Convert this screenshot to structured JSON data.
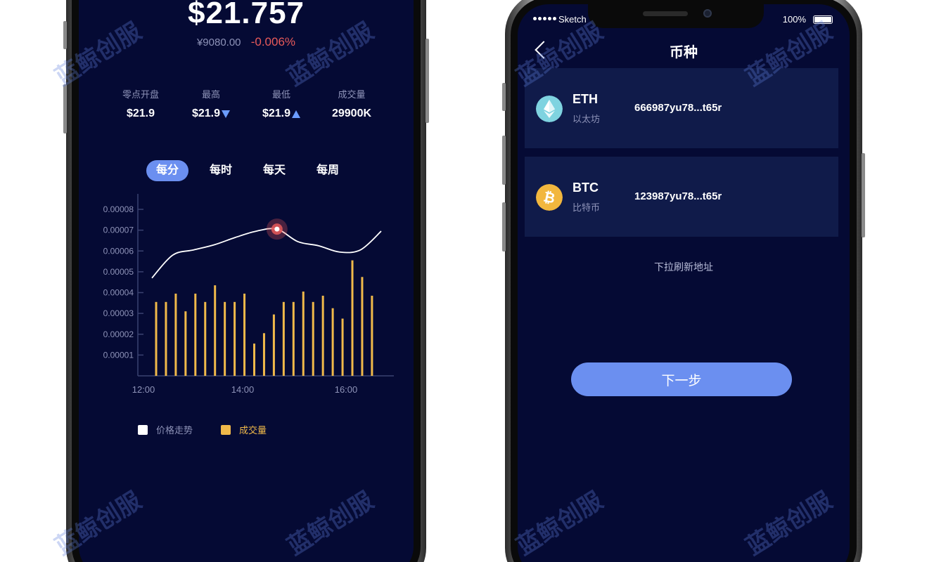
{
  "left_screen": {
    "price": "$21.757",
    "price_cny": "¥9080.00",
    "change": "-0.006%",
    "stats": [
      {
        "label": "零点开盘",
        "value": "$21.9",
        "arrow": "none"
      },
      {
        "label": "最高",
        "value": "$21.9",
        "arrow": "down"
      },
      {
        "label": "最低",
        "value": "$21.9",
        "arrow": "up"
      },
      {
        "label": "成交量",
        "value": "29900K",
        "arrow": "none"
      }
    ],
    "tabs": [
      "每分",
      "每时",
      "每天",
      "每周"
    ],
    "active_tab": "每分",
    "legend": [
      {
        "label": "价格走势",
        "color": "#ffffff"
      },
      {
        "label": "成交量",
        "color": "#f0b94a"
      }
    ]
  },
  "chart_data": {
    "type": "bar",
    "y_tick_labels": [
      "0.00008",
      "0.00007",
      "0.00006",
      "0.00005",
      "0.00004",
      "0.00003",
      "0.00002",
      "0.00001"
    ],
    "x_tick_labels": [
      "12:00",
      "14:00",
      "16:00"
    ],
    "ylim": [
      0,
      8e-05
    ],
    "series": [
      {
        "name": "成交量",
        "type": "bar",
        "color": "#f0b94a",
        "values": [
          3.55e-05,
          3.55e-05,
          3.95e-05,
          3.1e-05,
          3.95e-05,
          3.55e-05,
          4.35e-05,
          3.55e-05,
          3.55e-05,
          3.95e-05,
          1.55e-05,
          2.05e-05,
          2.95e-05,
          3.55e-05,
          3.55e-05,
          4.05e-05,
          3.55e-05,
          3.85e-05,
          3.25e-05,
          2.75e-05,
          5.55e-05,
          4.75e-05,
          3.85e-05
        ]
      },
      {
        "name": "价格走势",
        "type": "line",
        "color": "#ffffff",
        "values": [
          4.7e-05,
          5.8e-05,
          6.05e-05,
          6.3e-05,
          6.65e-05,
          6.95e-05,
          7.05e-05,
          6.45e-05,
          6.25e-05,
          5.95e-05,
          6.05e-05,
          6.95e-05
        ],
        "highlight_index": 6
      }
    ],
    "grid": false,
    "legend_position": "bottom-left"
  },
  "right_screen": {
    "status": {
      "carrier": "Sketch",
      "battery": "100%"
    },
    "title": "币种",
    "coins": [
      {
        "symbol": "ETH",
        "name": "以太坊",
        "address": "666987yu78...t65r",
        "icon": "ethereum-icon",
        "icon_color": "#7fd3e0"
      },
      {
        "symbol": "BTC",
        "name": "比特币",
        "address": "123987yu78...t65r",
        "icon": "bitcoin-icon",
        "icon_color": "#f2b73e"
      }
    ],
    "pull_tip": "下拉刷新地址",
    "next_button": "下一步"
  },
  "watermark": "蓝鲸创服",
  "colors": {
    "screen_bg": "#050a34",
    "card_bg": "#101b4a",
    "accent": "#6b8ff0",
    "negative": "#e85a5a",
    "bar": "#f0b94a"
  }
}
